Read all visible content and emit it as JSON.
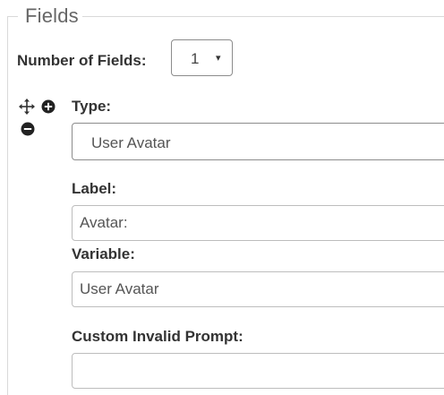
{
  "fieldset": {
    "legend": "Fields"
  },
  "number_of_fields": {
    "label": "Number of Fields:",
    "value": "1",
    "arrow": "▾"
  },
  "field_controls": {
    "move_icon": "move-arrows-icon",
    "add_icon": "plus-circle-icon",
    "remove_icon": "minus-circle-icon"
  },
  "field": {
    "type_label": "Type:",
    "type_value": "User Avatar",
    "label_label": "Label:",
    "label_value": "Avatar:",
    "variable_label": "Variable:",
    "variable_value": "User Avatar",
    "prompt_label": "Custom Invalid Prompt:",
    "prompt_value": ""
  }
}
